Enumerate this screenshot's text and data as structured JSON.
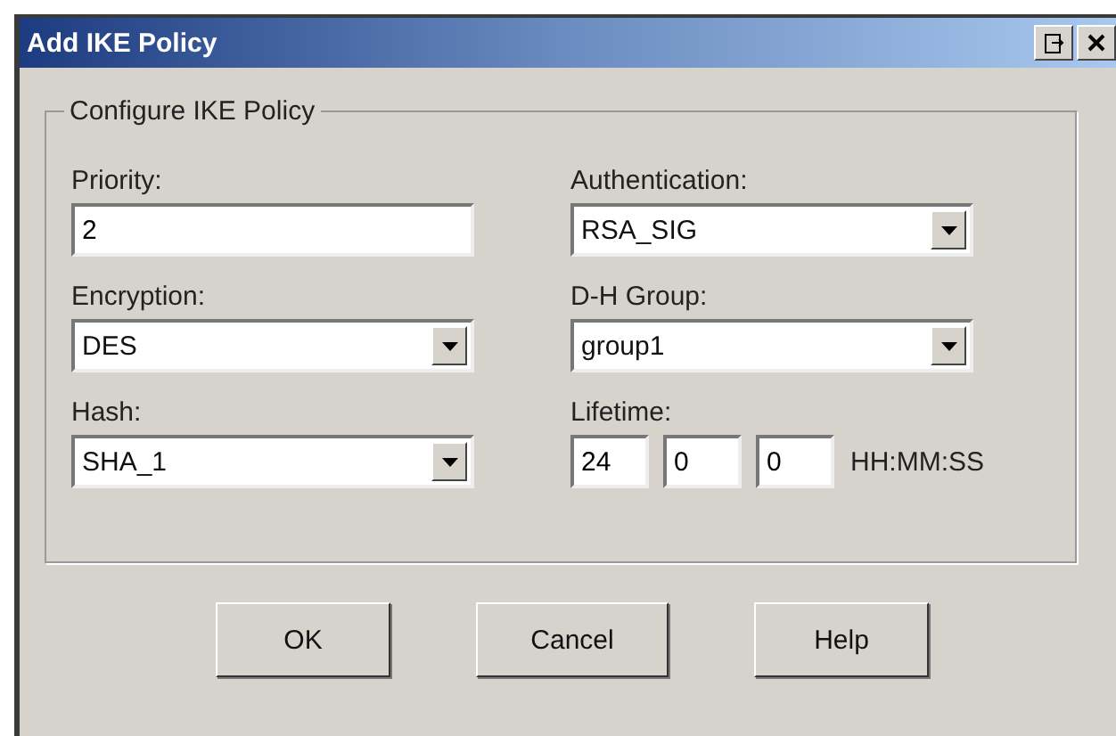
{
  "window": {
    "title": "Add IKE Policy"
  },
  "group": {
    "title": "Configure IKE Policy"
  },
  "fields": [
    {
      "kind": "text",
      "label": "Priority:",
      "value": "2"
    },
    {
      "kind": "select",
      "label": "Authentication:",
      "value": "RSA_SIG"
    },
    {
      "kind": "select",
      "label": "Encryption:",
      "value": "DES"
    },
    {
      "kind": "select",
      "label": "D-H Group:",
      "value": "group1"
    },
    {
      "kind": "select",
      "label": "Hash:",
      "value": "SHA_1"
    },
    {
      "kind": "time",
      "label": "Lifetime:",
      "values": [
        "24",
        "0",
        "0"
      ],
      "unit": "HH:MM:SS"
    }
  ],
  "buttons": [
    "OK",
    "Cancel",
    "Help"
  ]
}
